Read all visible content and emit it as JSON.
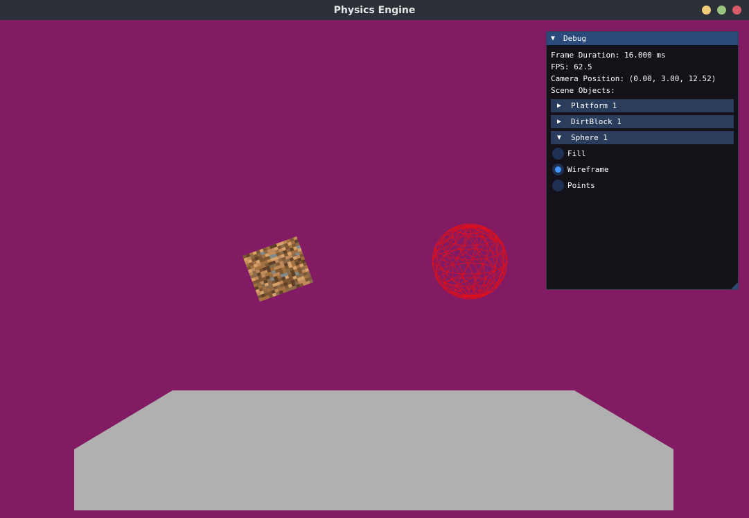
{
  "window": {
    "title": "Physics Engine",
    "controls": [
      "minimize",
      "maximize",
      "close"
    ]
  },
  "colors": {
    "titlebar": "#2c3038",
    "viewport_background": "#821b63",
    "platform": "#b0b0b0",
    "sphere_wireframe": "#e0101c",
    "dirt_light": "#c08a5a",
    "dirt_dark": "#6e4a2b",
    "minimize": "#f1cd7b",
    "maximize": "#9bc27e",
    "close": "#d95b6b",
    "imgui_title": "#294a7a",
    "imgui_header": "#2a3d5c",
    "imgui_check": "#4296fa"
  },
  "debug": {
    "title": "Debug",
    "title_arrow": "▼",
    "frame_duration": "Frame Duration: 16.000 ms",
    "fps": "FPS: 62.5",
    "camera_position": "Camera Position: (0.00, 3.00, 12.52)",
    "scene_objects_label": "Scene Objects:",
    "objects": [
      {
        "label": "Platform 1",
        "arrow": "▶",
        "expanded": false
      },
      {
        "label": "DirtBlock 1",
        "arrow": "▶",
        "expanded": false
      },
      {
        "label": "Sphere 1",
        "arrow": "▼",
        "expanded": true
      }
    ],
    "render_modes": [
      {
        "label": "Fill",
        "selected": false
      },
      {
        "label": "Wireframe",
        "selected": true
      },
      {
        "label": "Points",
        "selected": false
      }
    ]
  }
}
